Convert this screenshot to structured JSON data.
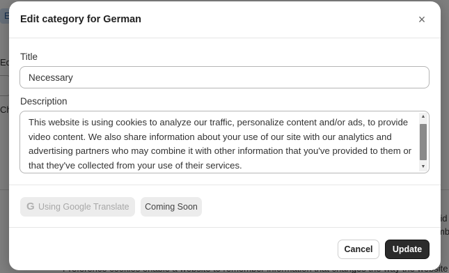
{
  "background": {
    "chip_text": "E",
    "label_ed": "Ed",
    "label_ch": "Ch",
    "text_right1": "rid",
    "text_right2": "mb",
    "bottom_text": "Preference cookies enable a website to remember information that changes the way the website"
  },
  "modal": {
    "title": "Edit category for German",
    "close_glyph": "×",
    "title_label": "Title",
    "title_value": "Necessary",
    "description_label": "Description",
    "description_value": "This website is using cookies to analyze our traffic, personalize content and/or ads, to provide video content. We also share information about your use of our site with our analytics and advertising partners who may combine it with other information that you've provided to them or that they've collected from your use of their services.",
    "translate_label": "Using Google Translate",
    "translate_icon": "G",
    "coming_soon_label": "Coming Soon",
    "cancel_label": "Cancel",
    "update_label": "Update"
  },
  "icons": {
    "close": "close-icon",
    "google": "google-g-icon",
    "scroll_up": "triangle-up",
    "scroll_down": "triangle-down"
  },
  "colors": {
    "primary_button": "#2b2b2b",
    "overlay": "rgba(0,0,0,0.5)",
    "chip_bg": "#ececec"
  }
}
